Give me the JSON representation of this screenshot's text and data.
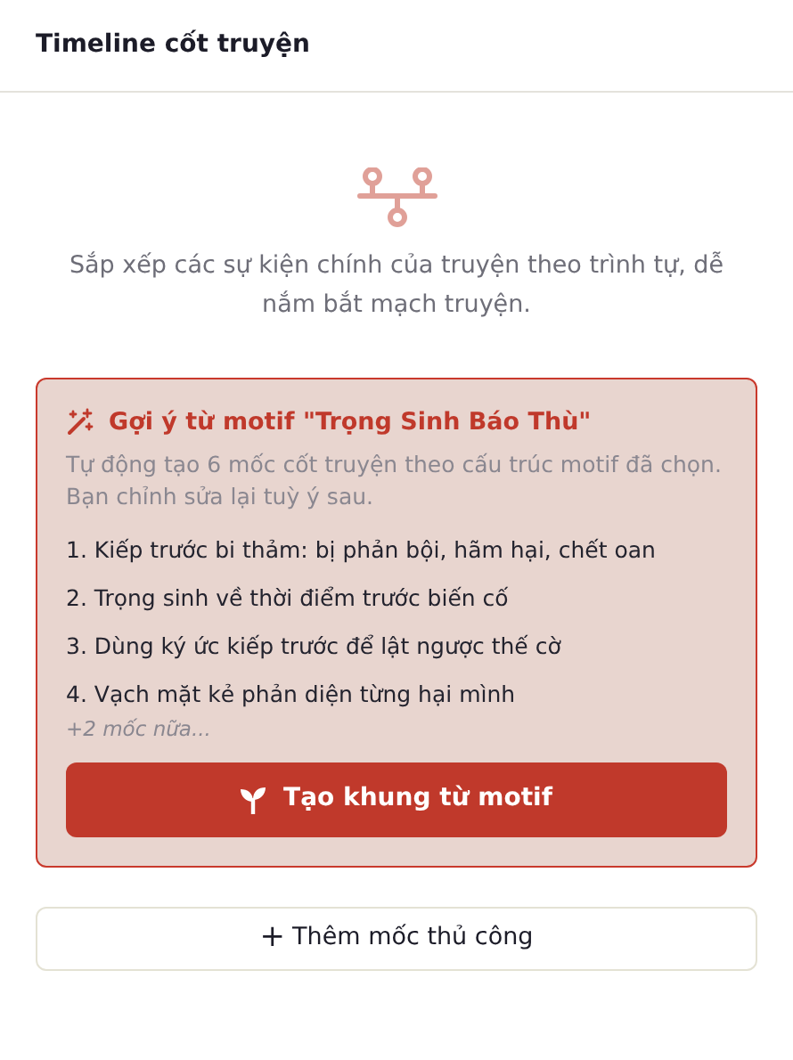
{
  "header": {
    "title": "Timeline cốt truyện"
  },
  "empty_state": {
    "description": "Sắp xếp các sự kiện chính của truyện theo trình tự, dễ nắm bắt mạch truyện."
  },
  "suggestion": {
    "title": "Gợi ý từ motif \"Trọng Sinh Báo Thù\"",
    "description": "Tự động tạo 6 mốc cốt truyện theo cấu trúc motif đã chọn. Bạn chỉnh sửa lại tuỳ ý sau.",
    "items": [
      "1. Kiếp trước bi thảm: bị phản bội, hãm hại, chết oan",
      "2. Trọng sinh về thời điểm trước biến cố",
      "3. Dùng ký ức kiếp trước để lật ngược thế cờ",
      "4. Vạch mặt kẻ phản diện từng hại mình"
    ],
    "more": "+2 mốc nữa...",
    "button": "Tạo khung từ motif"
  },
  "add_button": {
    "icon": "+",
    "label": "Thêm mốc thủ công"
  }
}
